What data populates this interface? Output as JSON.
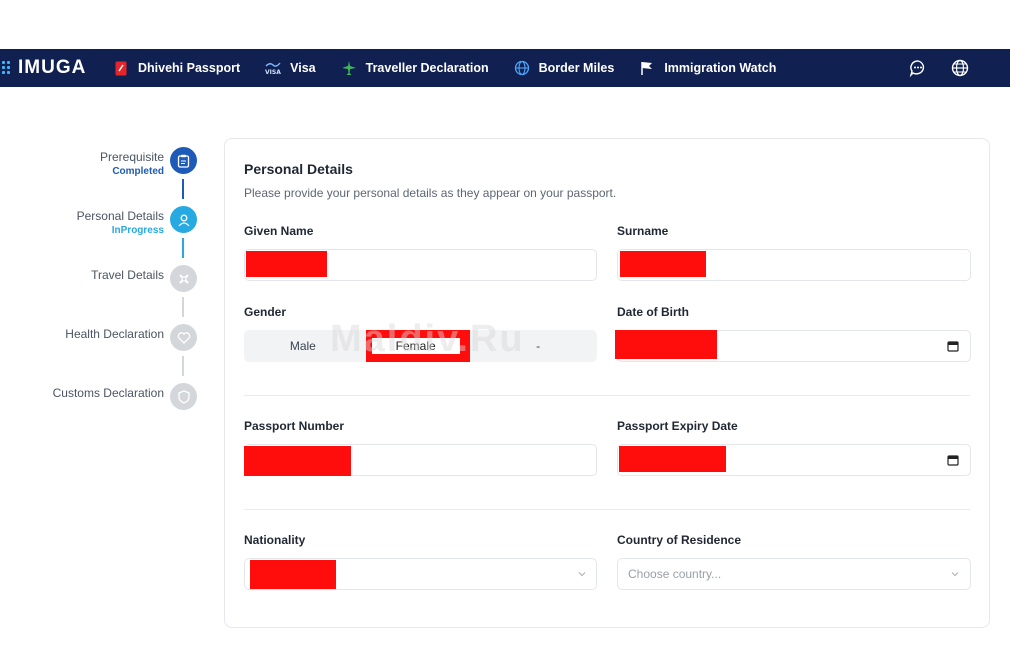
{
  "brand": {
    "logo": "IMUGA"
  },
  "nav": {
    "items": [
      {
        "label": "Dhivehi Passport",
        "icon": "passport-icon"
      },
      {
        "label": "Visa",
        "icon": "visa-icon"
      },
      {
        "label": "Traveller Declaration",
        "icon": "airplane-icon"
      },
      {
        "label": "Border Miles",
        "icon": "globe-icon"
      },
      {
        "label": "Immigration Watch",
        "icon": "flag-icon"
      }
    ],
    "right_icons": [
      "chat-icon",
      "language-globe-icon"
    ]
  },
  "stepper": {
    "steps": [
      {
        "label": "Prerequisite",
        "status": "Completed",
        "icon": "clipboard-icon"
      },
      {
        "label": "Personal Details",
        "status": "InProgress",
        "icon": "user-icon"
      },
      {
        "label": "Travel Details",
        "status": "",
        "icon": "plane-cross-icon"
      },
      {
        "label": "Health Declaration",
        "status": "",
        "icon": "heart-icon"
      },
      {
        "label": "Customs Declaration",
        "status": "",
        "icon": "shield-icon"
      }
    ]
  },
  "form": {
    "title": "Personal Details",
    "subtitle": "Please provide your personal details as they appear on your passport.",
    "given_name_label": "Given Name",
    "surname_label": "Surname",
    "gender_label": "Gender",
    "gender_options": [
      "Male",
      "Female",
      "-"
    ],
    "gender_selected": "Female",
    "dob_label": "Date of Birth",
    "passport_number_label": "Passport Number",
    "passport_expiry_label": "Passport Expiry Date",
    "nationality_label": "Nationality",
    "residence_label": "Country of Residence",
    "residence_placeholder": "Choose country..."
  },
  "watermark": "Maldiv.Ru",
  "colors": {
    "nav_bg": "#0f2051",
    "completed": "#1e5bb8",
    "in_progress": "#27a9e1",
    "pending": "#d3d6db",
    "redaction": "#ff0d0d"
  }
}
